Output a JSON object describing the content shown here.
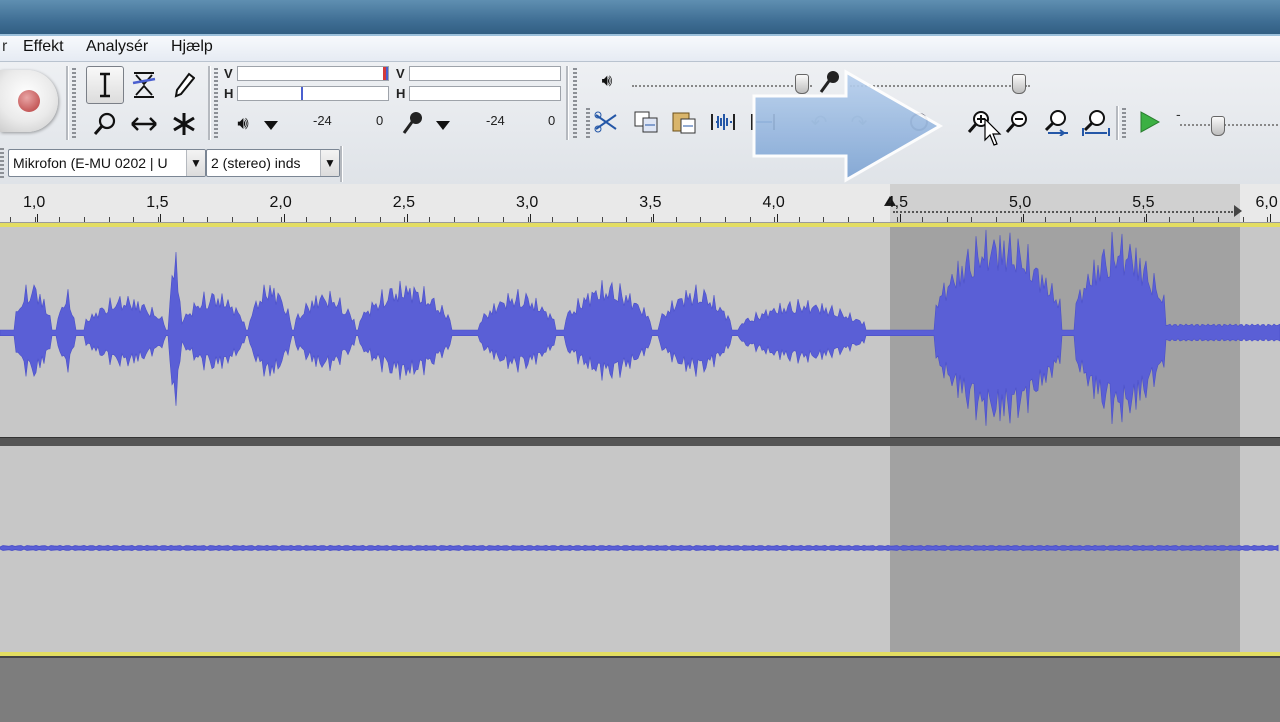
{
  "menu": {
    "items": [
      {
        "label": "Effekt"
      },
      {
        "label": "Analysér"
      },
      {
        "label": "Hjælp"
      }
    ]
  },
  "meters": {
    "playback_top_label": "V",
    "playback_bottom_label": "H",
    "record_top_label": "V",
    "record_bottom_label": "H",
    "playback_db_mid": "-24",
    "playback_db_end": "0",
    "record_db_mid": "-24",
    "record_db_end": "0"
  },
  "devices": {
    "input_device": "Mikrofon (E-MU 0202 | U",
    "channels": "2 (stereo) inds"
  },
  "timeline": {
    "ticks": [
      "1,0",
      "1,5",
      "2,0",
      "2,5",
      "3,0",
      "3,5",
      "4,0",
      "4,5",
      "5,0",
      "5,5",
      "6,0"
    ]
  },
  "icons": {
    "record": "record-icon",
    "selection_tool": "i-beam-icon",
    "envelope_tool": "envelope-icon",
    "draw_tool": "pencil-icon",
    "zoom_tool": "magnifier-icon",
    "timeshift_tool": "double-arrow-icon",
    "multi_tool": "asterisk-icon",
    "zoom_in": "zoom-in-icon",
    "zoom_out": "zoom-out-icon",
    "play": "play-icon"
  },
  "colors": {
    "waveform": "#5a5fd6",
    "selection": "#a2a2a2",
    "track_bg": "#c7c7c7",
    "yellow_border": "#e3dd62",
    "play_green": "#3cb043",
    "tutorial_arrow": "#8fb3dc"
  },
  "selection": {
    "start_seconds": 4.45,
    "end_seconds": 5.88
  }
}
